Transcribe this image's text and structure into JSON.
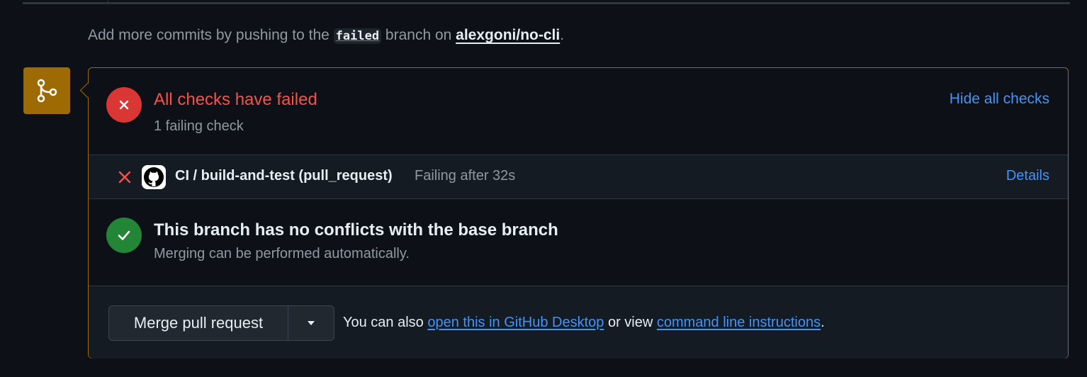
{
  "commit_hint": {
    "prefix": "Add more commits by pushing to the ",
    "branch": "failed",
    "middle": " branch on ",
    "repo": "alexgoni/no-cli",
    "suffix": "."
  },
  "merge_badge": {
    "icon": "git-merge-icon",
    "color": "#9e6a03"
  },
  "checks": {
    "title": "All checks have failed",
    "subtitle": "1 failing check",
    "toggle_label": "Hide all checks",
    "status_icon": "x-circle-icon",
    "status_color": "#da3633",
    "items": [
      {
        "name": "CI / build-and-test (pull_request)",
        "status": "Failing after 32s",
        "details_label": "Details",
        "icon": "x-icon",
        "avatar": "github-icon"
      }
    ]
  },
  "conflicts": {
    "title": "This branch has no conflicts with the base branch",
    "subtitle": "Merging can be performed automatically.",
    "status_icon": "check-circle-icon",
    "status_color": "#238636"
  },
  "merge": {
    "button_label": "Merge pull request",
    "dropdown_icon": "triangle-down-icon",
    "hint_prefix": "You can also ",
    "desktop_link": "open this in GitHub Desktop",
    "hint_middle": " or view ",
    "cli_link": "command line instructions",
    "hint_suffix": "."
  },
  "colors": {
    "background": "#0d1117",
    "accent_link": "#4493f8",
    "danger": "#f85149",
    "warning_border": "#9e6a03"
  }
}
